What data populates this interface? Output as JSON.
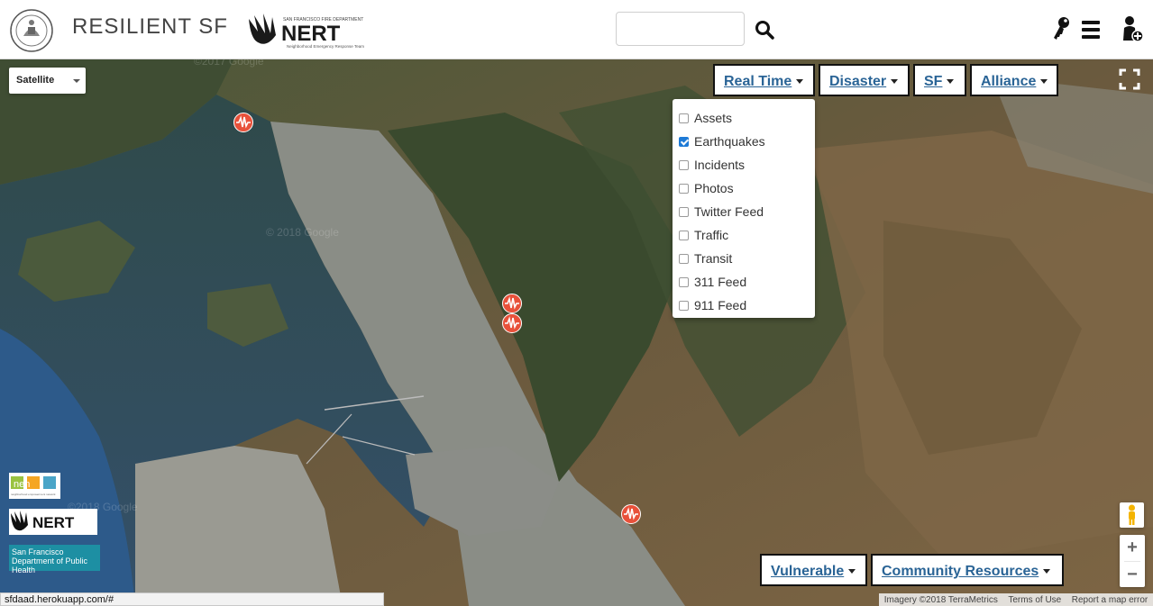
{
  "header": {
    "title": "RESILIENT SF",
    "nert_logo_text": "NERT",
    "nert_logo_subtitle": "Neighborhood Emergency Response Team",
    "nert_logo_dept": "SAN FRANCISCO FIRE DEPARTMENT",
    "search": {
      "value": "",
      "placeholder": ""
    },
    "icons": [
      "seal-icon",
      "search-icon",
      "key-icon",
      "menu-icon",
      "add-person-icon"
    ]
  },
  "map": {
    "map_type": "Satellite",
    "layer_buttons": {
      "real_time": "Real Time",
      "disaster": "Disaster",
      "sf": "SF",
      "alliance": "Alliance",
      "vulnerable": "Vulnerable",
      "community": "Community Resources"
    },
    "real_time_menu": [
      {
        "label": "Assets",
        "checked": false
      },
      {
        "label": "Earthquakes",
        "checked": true
      },
      {
        "label": "Incidents",
        "checked": false
      },
      {
        "label": "Photos",
        "checked": false
      },
      {
        "label": "Twitter Feed",
        "checked": false
      },
      {
        "label": "Traffic",
        "checked": false
      },
      {
        "label": "Transit",
        "checked": false
      },
      {
        "label": "311 Feed",
        "checked": false
      },
      {
        "label": "911 Feed",
        "checked": false
      }
    ],
    "earthquake_marker_color": "#e8513a",
    "zoom_in": "+",
    "zoom_out": "−",
    "partners": {
      "nen": "nen",
      "nen_sub": "neighborhood empowerment network",
      "nert": "NERT",
      "dph_line1": "San Francisco",
      "dph_line2": "Department of Public Health"
    },
    "watermarks": [
      "©2017 Google",
      "© 2018 Google",
      "©2018 Google"
    ],
    "attribution": {
      "imagery": "Imagery ©2018 TerraMetrics",
      "terms": "Terms of Use",
      "report": "Report a map error"
    }
  },
  "status_bar": {
    "url": "sfdaad.herokuapp.com/#"
  },
  "colors": {
    "link": "#2a6496",
    "checkbox": "#1e7ad6",
    "dph": "#1d8fa3"
  }
}
